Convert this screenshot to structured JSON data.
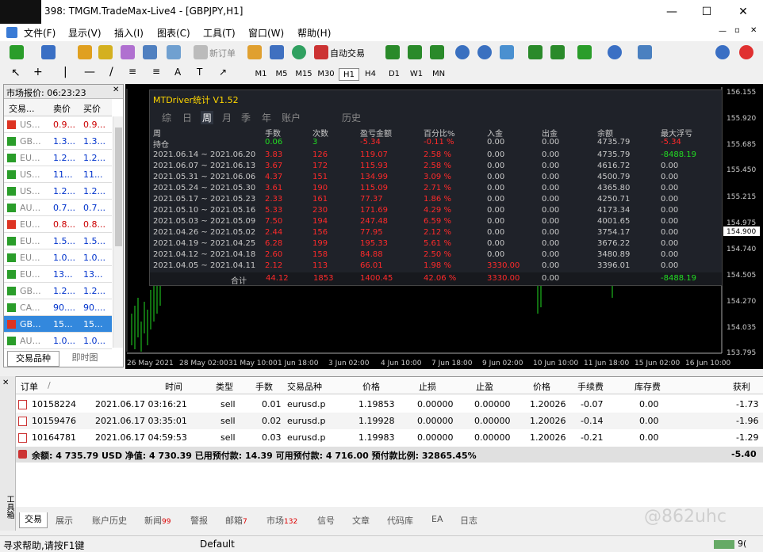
{
  "window": {
    "title": "398: TMGM.TradeMax-Live4 - [GBPJPY,H1]",
    "minimize": "—",
    "maximize": "☐",
    "close": "✕"
  },
  "menu": [
    "文件(F)",
    "显示(V)",
    "插入(I)",
    "图表(C)",
    "工具(T)",
    "窗口(W)",
    "帮助(H)"
  ],
  "toolbar": {
    "new_order": "新订单",
    "auto_trade": "自动交易"
  },
  "timeframes": [
    "M1",
    "M5",
    "M15",
    "M30",
    "H1",
    "H4",
    "D1",
    "W1",
    "MN"
  ],
  "market": {
    "title": "市场报价: 06:23:23",
    "cols": [
      "交易...",
      "卖价",
      "买价"
    ],
    "rows": [
      {
        "sym": "US...",
        "bid": "0.9...",
        "ask": "0.9...",
        "dir": "down",
        "blue": false
      },
      {
        "sym": "GB...",
        "bid": "1.3...",
        "ask": "1.3...",
        "dir": "up",
        "blue": true
      },
      {
        "sym": "EU...",
        "bid": "1.2...",
        "ask": "1.2...",
        "dir": "up",
        "blue": true
      },
      {
        "sym": "US...",
        "bid": "11...",
        "ask": "11...",
        "dir": "up",
        "blue": true
      },
      {
        "sym": "US...",
        "bid": "1.2...",
        "ask": "1.2...",
        "dir": "up",
        "blue": true
      },
      {
        "sym": "AU...",
        "bid": "0.7...",
        "ask": "0.7...",
        "dir": "up",
        "blue": true
      },
      {
        "sym": "EU...",
        "bid": "0.8...",
        "ask": "0.8...",
        "dir": "down",
        "blue": false
      },
      {
        "sym": "EU...",
        "bid": "1.5...",
        "ask": "1.5...",
        "dir": "up",
        "blue": true
      },
      {
        "sym": "EU...",
        "bid": "1.0...",
        "ask": "1.0...",
        "dir": "up",
        "blue": true
      },
      {
        "sym": "EU...",
        "bid": "13...",
        "ask": "13...",
        "dir": "up",
        "blue": true
      },
      {
        "sym": "GB...",
        "bid": "1.2...",
        "ask": "1.2...",
        "dir": "up",
        "blue": true
      },
      {
        "sym": "CA...",
        "bid": "90....",
        "ask": "90....",
        "dir": "up",
        "blue": true
      },
      {
        "sym": "GB...",
        "bid": "15...",
        "ask": "15...",
        "dir": "down",
        "blue": false,
        "sel": true
      },
      {
        "sym": "AU...",
        "bid": "1.0...",
        "ask": "1.0...",
        "dir": "up",
        "blue": true
      }
    ],
    "tabs": [
      "交易品种",
      "即时图"
    ]
  },
  "chart": {
    "y_ticks": [
      "156.155",
      "155.920",
      "155.685",
      "155.450",
      "155.215",
      "154.975",
      "154.900",
      "154.740",
      "154.505",
      "154.270",
      "154.035",
      "153.795"
    ],
    "x_ticks": [
      "26 May 2021",
      "28 May 02:00",
      "31 May 10:00",
      "1 Jun 18:00",
      "3 Jun 02:00",
      "4 Jun 10:00",
      "7 Jun 18:00",
      "9 Jun 02:00",
      "10 Jun 10:00",
      "11 Jun 18:00",
      "15 Jun 02:00",
      "16 Jun 10:00"
    ],
    "price_label": "154.900"
  },
  "stats": {
    "title": "MTDriver统计 V1.52",
    "tabs": [
      "综",
      "日",
      "周",
      "月",
      "季",
      "年",
      "账户",
      "历史"
    ],
    "headers": [
      "周",
      "手数",
      "次数",
      "盈亏金额",
      "百分比%",
      "入金",
      "出金",
      "余额",
      "最大浮亏"
    ],
    "hold": {
      "label": "持仓",
      "lots": "0.06",
      "count": "3",
      "pnl": "-5.34",
      "pct": "-0.11 %",
      "dep": "0.00",
      "wd": "0.00",
      "bal": "4735.79",
      "dd": "-5.34"
    },
    "rows": [
      [
        "2021.06.14 ~ 2021.06.20",
        "3.83",
        "126",
        "119.07",
        "2.58 %",
        "0.00",
        "0.00",
        "4735.79",
        "-8488.19"
      ],
      [
        "2021.06.07 ~ 2021.06.13",
        "3.67",
        "172",
        "115.93",
        "2.58 %",
        "0.00",
        "0.00",
        "4616.72",
        "0.00"
      ],
      [
        "2021.05.31 ~ 2021.06.06",
        "4.37",
        "151",
        "134.99",
        "3.09 %",
        "0.00",
        "0.00",
        "4500.79",
        "0.00"
      ],
      [
        "2021.05.24 ~ 2021.05.30",
        "3.61",
        "190",
        "115.09",
        "2.71 %",
        "0.00",
        "0.00",
        "4365.80",
        "0.00"
      ],
      [
        "2021.05.17 ~ 2021.05.23",
        "2.33",
        "161",
        "77.37",
        "1.86 %",
        "0.00",
        "0.00",
        "4250.71",
        "0.00"
      ],
      [
        "2021.05.10 ~ 2021.05.16",
        "5.33",
        "230",
        "171.69",
        "4.29 %",
        "0.00",
        "0.00",
        "4173.34",
        "0.00"
      ],
      [
        "2021.05.03 ~ 2021.05.09",
        "7.50",
        "194",
        "247.48",
        "6.59 %",
        "0.00",
        "0.00",
        "4001.65",
        "0.00"
      ],
      [
        "2021.04.26 ~ 2021.05.02",
        "2.44",
        "156",
        "77.95",
        "2.12 %",
        "0.00",
        "0.00",
        "3754.17",
        "0.00"
      ],
      [
        "2021.04.19 ~ 2021.04.25",
        "6.28",
        "199",
        "195.33",
        "5.61 %",
        "0.00",
        "0.00",
        "3676.22",
        "0.00"
      ],
      [
        "2021.04.12 ~ 2021.04.18",
        "2.60",
        "158",
        "84.88",
        "2.50 %",
        "0.00",
        "0.00",
        "3480.89",
        "0.00"
      ],
      [
        "2021.04.05 ~ 2021.04.11",
        "2.12",
        "113",
        "66.01",
        "1.98 %",
        "3330.00",
        "0.00",
        "3396.01",
        "0.00"
      ]
    ],
    "total": {
      "label": "合计",
      "lots": "44.12",
      "count": "1853",
      "pnl": "1400.45",
      "pct": "42.06 %",
      "dep": "3330.00",
      "wd": "0.00",
      "dd": "-8488.19"
    }
  },
  "orders": {
    "headers": [
      "订单",
      "/",
      "时间",
      "类型",
      "手数",
      "交易品种",
      "价格",
      "止损",
      "止盈",
      "价格",
      "手续费",
      "库存费",
      "获利"
    ],
    "rows": [
      [
        "10158224",
        "2021.06.17 03:16:21",
        "sell",
        "0.01",
        "eurusd.p",
        "1.19853",
        "0.00000",
        "0.00000",
        "1.20026",
        "-0.07",
        "0.00",
        "-1.73"
      ],
      [
        "10159476",
        "2021.06.17 03:35:01",
        "sell",
        "0.02",
        "eurusd.p",
        "1.19928",
        "0.00000",
        "0.00000",
        "1.20026",
        "-0.14",
        "0.00",
        "-1.96"
      ],
      [
        "10164781",
        "2021.06.17 04:59:53",
        "sell",
        "0.03",
        "eurusd.p",
        "1.19983",
        "0.00000",
        "0.00000",
        "1.20026",
        "-0.21",
        "0.00",
        "-1.29"
      ]
    ],
    "summary": "余额: 4 735.79 USD  净值: 4 730.39  已用预付款: 14.39  可用预付款: 4 716.00  预付款比例: 32865.45%",
    "summary_total": "-5.40"
  },
  "bottom_tabs": [
    {
      "label": "交易",
      "badge": ""
    },
    {
      "label": "展示",
      "badge": ""
    },
    {
      "label": "账户历史",
      "badge": ""
    },
    {
      "label": "新闻",
      "badge": "99"
    },
    {
      "label": "警报",
      "badge": ""
    },
    {
      "label": "邮箱",
      "badge": "7"
    },
    {
      "label": "市场",
      "badge": "132"
    },
    {
      "label": "信号",
      "badge": ""
    },
    {
      "label": "文章",
      "badge": ""
    },
    {
      "label": "代码库",
      "badge": ""
    },
    {
      "label": "EA",
      "badge": ""
    },
    {
      "label": "日志",
      "badge": ""
    }
  ],
  "side_label": "工具箱",
  "watermark": "@862uhc",
  "status": {
    "help": "寻求帮助,请按F1键",
    "profile": "Default",
    "conn": "9("
  }
}
